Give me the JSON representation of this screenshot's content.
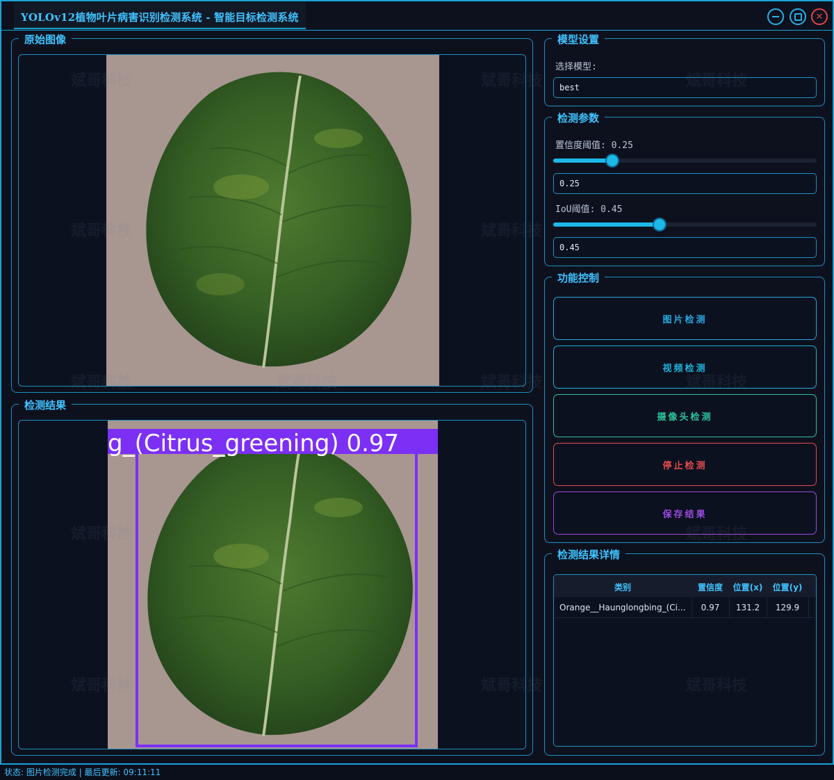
{
  "window": {
    "title": "YOLOv12植物叶片病害识别检测系统 - 智能目标检测系统"
  },
  "panels": {
    "original": {
      "title": "原始图像"
    },
    "result": {
      "title": "检测结果"
    }
  },
  "detection_overlay": {
    "label": "g_(Citrus_greening) 0.97",
    "box_color": "#7c2ff5"
  },
  "model_settings": {
    "title": "模型设置",
    "select_label": "选择模型:",
    "selected_model": "best"
  },
  "params": {
    "title": "检测参数",
    "confidence": {
      "label": "置信度阈值: 0.25",
      "value": 0.25,
      "input": "0.25"
    },
    "iou": {
      "label": "IoU阈值: 0.45",
      "value": 0.45,
      "input": "0.45"
    }
  },
  "controls": {
    "title": "功能控制",
    "buttons": [
      {
        "label": "图片检测",
        "color": "#28a8e0"
      },
      {
        "label": "视频检测",
        "color": "#1fb2d8"
      },
      {
        "label": "摄像头检测",
        "color": "#2cc39a"
      },
      {
        "label": "停止检测",
        "color": "#e54b4b"
      },
      {
        "label": "保存结果",
        "color": "#9b4ae0"
      }
    ]
  },
  "details": {
    "title": "检测结果详情",
    "columns": [
      "类别",
      "置信度",
      "位置(x)",
      "位置(y)"
    ],
    "rows": [
      [
        "Orange__Haunglongbing_(Ci...",
        "0.97",
        "131.2",
        "129.9"
      ]
    ]
  },
  "watermark": "斌哥科技",
  "status": {
    "text": "状态: 图片检测完成 | 最后更新: 09:11:11"
  },
  "colors": {
    "accent": "#1aa3d6",
    "title_text": "#3fc3ff",
    "background": "#0d111e"
  }
}
